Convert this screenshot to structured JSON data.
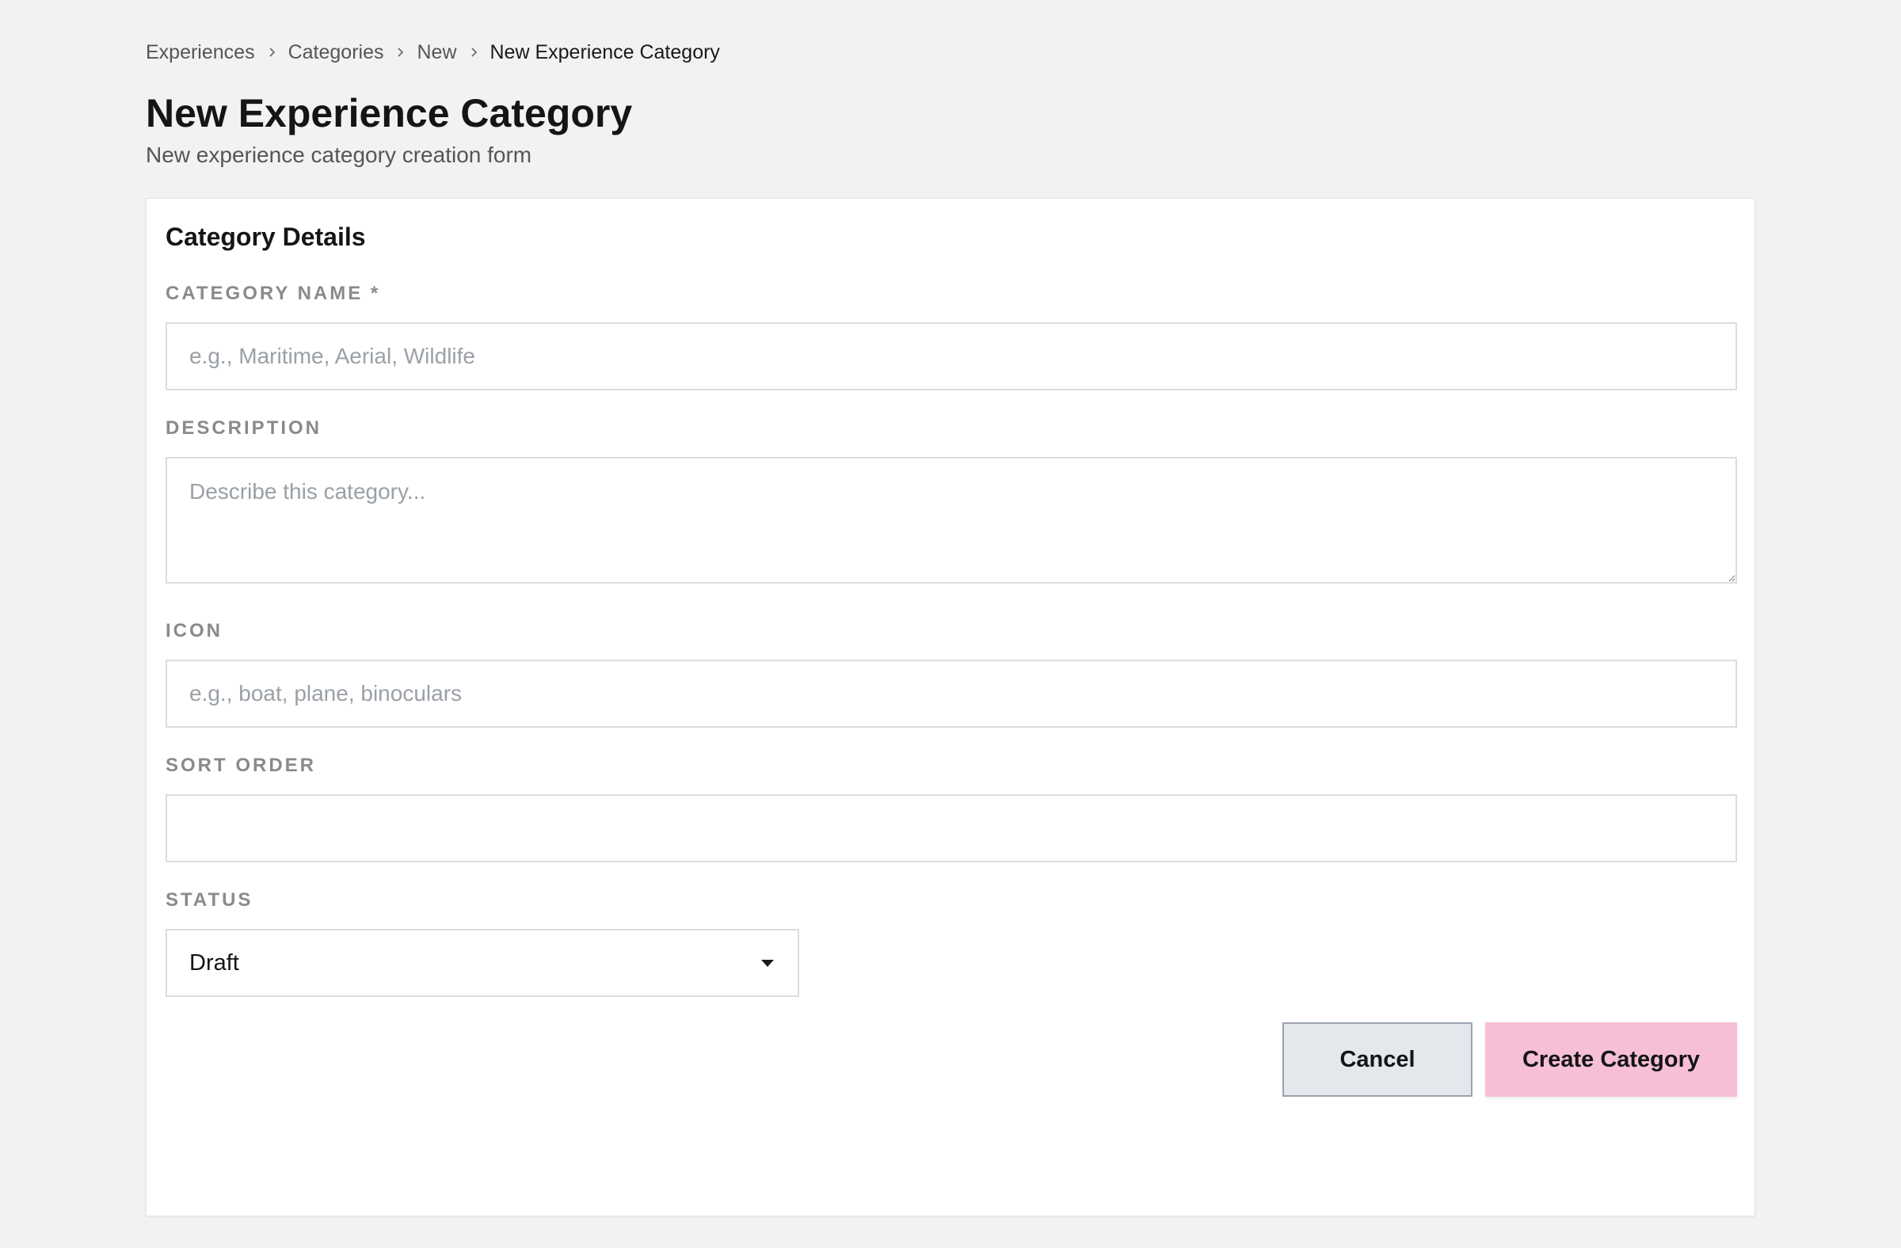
{
  "breadcrumb": {
    "items": [
      "Experiences",
      "Categories",
      "New"
    ],
    "current": "New Experience Category"
  },
  "header": {
    "title": "New Experience Category",
    "subtitle": "New experience category creation form"
  },
  "form": {
    "section_title": "Category Details",
    "category_name": {
      "label": "CATEGORY NAME *",
      "placeholder": "e.g., Maritime, Aerial, Wildlife",
      "value": ""
    },
    "description": {
      "label": "DESCRIPTION",
      "placeholder": "Describe this category...",
      "value": ""
    },
    "icon": {
      "label": "ICON",
      "placeholder": "e.g., boat, plane, binoculars",
      "value": ""
    },
    "sort_order": {
      "label": "SORT ORDER",
      "placeholder": "",
      "value": ""
    },
    "status": {
      "label": "STATUS",
      "selected": "Draft"
    }
  },
  "actions": {
    "cancel_label": "Cancel",
    "create_label": "Create Category"
  },
  "colors": {
    "background": "#f2f2f2",
    "card": "#ffffff",
    "primary_button": "#f6bfd6",
    "secondary_button": "#e4e7eb",
    "label": "#8a8a8a"
  },
  "icons": {
    "breadcrumb_separator": "chevron-right-icon",
    "select_caret": "caret-down-icon",
    "textarea_resize": "resize-grip-icon"
  }
}
